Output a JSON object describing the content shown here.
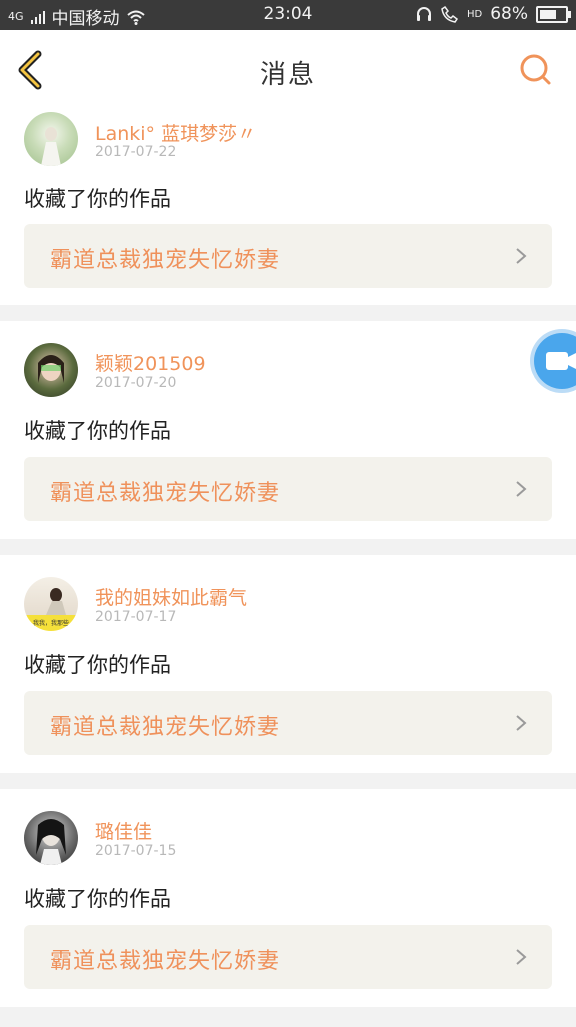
{
  "status_bar": {
    "network": "4G",
    "carrier": "中国移动",
    "time": "23:04",
    "signal_hd": "HD",
    "battery_percent": "68%",
    "battery_level": 0.68
  },
  "header": {
    "title": "消息",
    "back_icon": "back-chevron-icon",
    "search_icon": "search-icon"
  },
  "colors": {
    "accent": "#f0935a",
    "card_bg": "#f3f2ec",
    "separator": "#f2f2f2",
    "status_bg": "#3a3a3a",
    "video_button": "#4aa6ec"
  },
  "messages": [
    {
      "username": "Lanki° 蓝琪梦莎〃",
      "date": "2017-07-22",
      "action": "收藏了你的作品",
      "work_title": "霸道总裁独宠失忆娇妻"
    },
    {
      "username": "颖颖201509",
      "date": "2017-07-20",
      "action": "收藏了你的作品",
      "work_title": "霸道总裁独宠失忆娇妻"
    },
    {
      "username": "我的姐妹如此霸气",
      "date": "2017-07-17",
      "action": "收藏了你的作品",
      "work_title": "霸道总裁独宠失忆娇妻",
      "avatar_caption": "我我，我那些"
    },
    {
      "username": "璐佳佳",
      "date": "2017-07-15",
      "action": "收藏了你的作品",
      "work_title": "霸道总裁独宠失忆娇妻"
    }
  ],
  "floating_button": {
    "icon": "video-camera-icon"
  }
}
